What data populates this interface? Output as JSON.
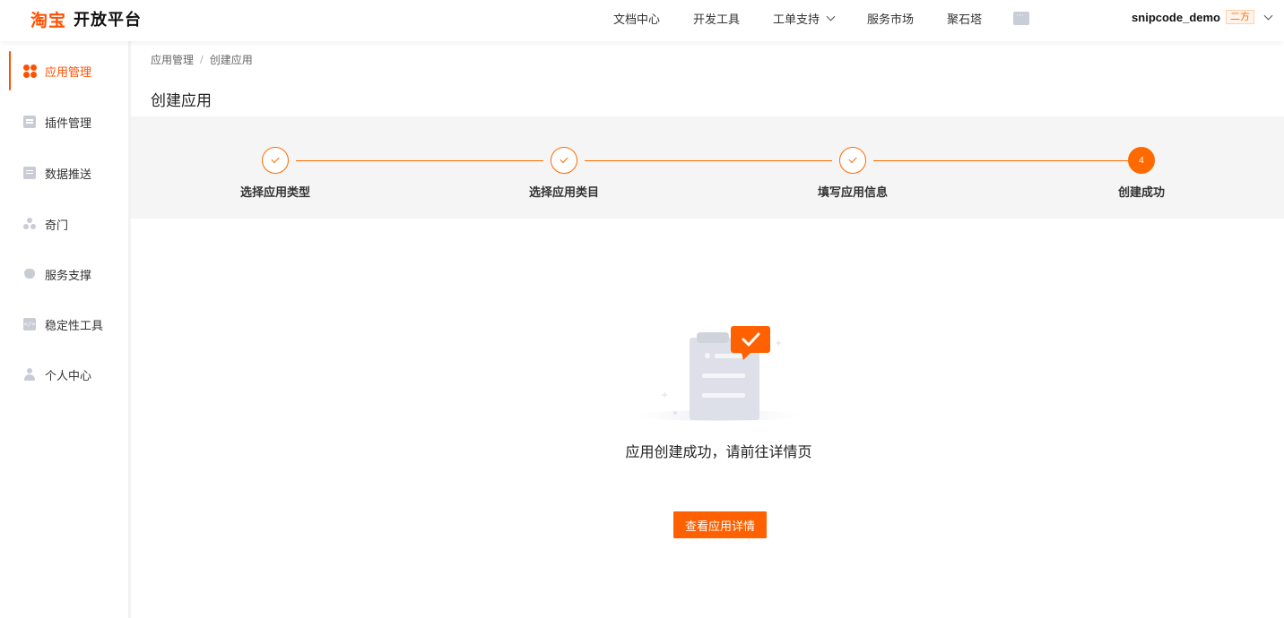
{
  "header": {
    "logo_brand": "淘宝",
    "logo_text": "开放平台",
    "nav": [
      {
        "label": "文档中心"
      },
      {
        "label": "开发工具"
      },
      {
        "label": "工单支持"
      },
      {
        "label": "服务市场"
      },
      {
        "label": "聚石塔"
      }
    ],
    "message_icon": "message-icon",
    "user": {
      "name": "snipcode_demo",
      "tag": "二方"
    }
  },
  "sidebar": {
    "items": [
      {
        "label": "应用管理",
        "icon": "app-grid-icon",
        "active": true
      },
      {
        "label": "插件管理",
        "icon": "plugin-icon",
        "active": false
      },
      {
        "label": "数据推送",
        "icon": "data-push-icon",
        "active": false
      },
      {
        "label": "奇门",
        "icon": "qimen-icon",
        "active": false
      },
      {
        "label": "服务支撑",
        "icon": "heart-icon",
        "active": false
      },
      {
        "label": "稳定性工具",
        "icon": "code-icon",
        "active": false
      },
      {
        "label": "个人中心",
        "icon": "person-icon",
        "active": false
      }
    ]
  },
  "breadcrumb": {
    "parent": "应用管理",
    "separator": "/",
    "current": "创建应用"
  },
  "page": {
    "title": "创建应用"
  },
  "steps": [
    {
      "label": "选择应用类型",
      "status": "done"
    },
    {
      "label": "选择应用类目",
      "status": "done"
    },
    {
      "label": "填写应用信息",
      "status": "done"
    },
    {
      "label": "创建成功",
      "status": "current",
      "number": "4"
    }
  ],
  "result": {
    "message": "应用创建成功，请前往详情页",
    "button_label": "查看应用详情"
  },
  "colors": {
    "accent": "#ff5000",
    "step": "#ff6a00",
    "band": "#f5f5f5"
  }
}
